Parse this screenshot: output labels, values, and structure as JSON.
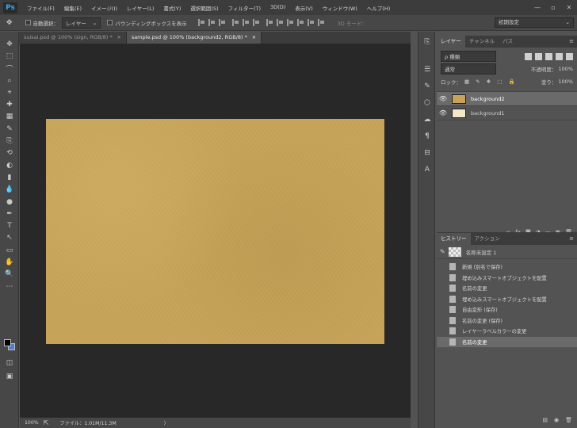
{
  "app": {
    "logo": "Ps",
    "menu": [
      "ファイル(F)",
      "編集(E)",
      "イメージ(I)",
      "レイヤー(L)",
      "書式(Y)",
      "選択範囲(S)",
      "フィルター(T)",
      "3D(D)",
      "表示(V)",
      "ウィンドウ(W)",
      "ヘルプ(H)"
    ],
    "window_controls": [
      "—",
      "▫",
      "✕"
    ]
  },
  "options": {
    "auto_select_label": "自動選択：",
    "auto_select_target": "レイヤー",
    "bounding_box_label": "バウンディングボックスを表示",
    "mode_3d_label": "3D モード：",
    "workspace": "初期設定"
  },
  "tabs": [
    {
      "label": "suisai.psd @ 100% (sign, RGB/8) *",
      "close": "✕"
    },
    {
      "label": "sample.psd @ 100% (background2, RGB/8) *",
      "close": "✕"
    }
  ],
  "tools": [
    "✥",
    "⬚",
    "⌒",
    "⌕",
    "⌖",
    "✚",
    "▦",
    "✎",
    "⎘",
    "⟲",
    "◐",
    "▮",
    "💧",
    "●",
    "✒",
    "T",
    "↖",
    "▭",
    "✋",
    "🔍",
    "⋯"
  ],
  "status": {
    "zoom": "100%",
    "file_info": "ファイル：1.01M/11.3M",
    "arrow": "〉"
  },
  "layers_panel": {
    "tabs": [
      "レイヤー",
      "チャンネル",
      "パス"
    ],
    "menu_icon": "≡",
    "kind_filter": "ρ 種類",
    "blend_mode": "通常",
    "opacity_label": "不透明度：",
    "opacity_value": "100%",
    "lock_label": "ロック：",
    "fill_label": "塗り：",
    "fill_value": "100%",
    "layers": [
      {
        "name": "background2",
        "thumb_color": "#c6a358",
        "selected": true
      },
      {
        "name": "background1",
        "thumb_color": "#f2e7c8",
        "selected": false
      }
    ],
    "bottom_icons": [
      "∞",
      "fx",
      "◙",
      "◑",
      "▭",
      "▣",
      "🗑"
    ]
  },
  "history_panel": {
    "tabs": [
      "ヒストリー",
      "アクション"
    ],
    "menu_icon": "≡",
    "snapshot_label": "名称未設定 1",
    "items": [
      {
        "label": "新規 (別名で保存)",
        "selected": false
      },
      {
        "label": "埋め込みスマートオブジェクトを配置",
        "selected": false
      },
      {
        "label": "名前の変更",
        "selected": false
      },
      {
        "label": "埋め込みスマートオブジェクトを配置",
        "selected": false
      },
      {
        "label": "自由変形 (保存)",
        "selected": false
      },
      {
        "label": "名前の変更 (保存)",
        "selected": false
      },
      {
        "label": "レイヤーラベルカラーの変更",
        "selected": false
      },
      {
        "label": "名前の変更",
        "selected": true
      }
    ],
    "bottom_icons": [
      "▤",
      "◉",
      "🗑"
    ]
  },
  "colors": {
    "foreground": "#000000",
    "background": "#4a7fd1",
    "canvas_fill": "#c6a358"
  }
}
